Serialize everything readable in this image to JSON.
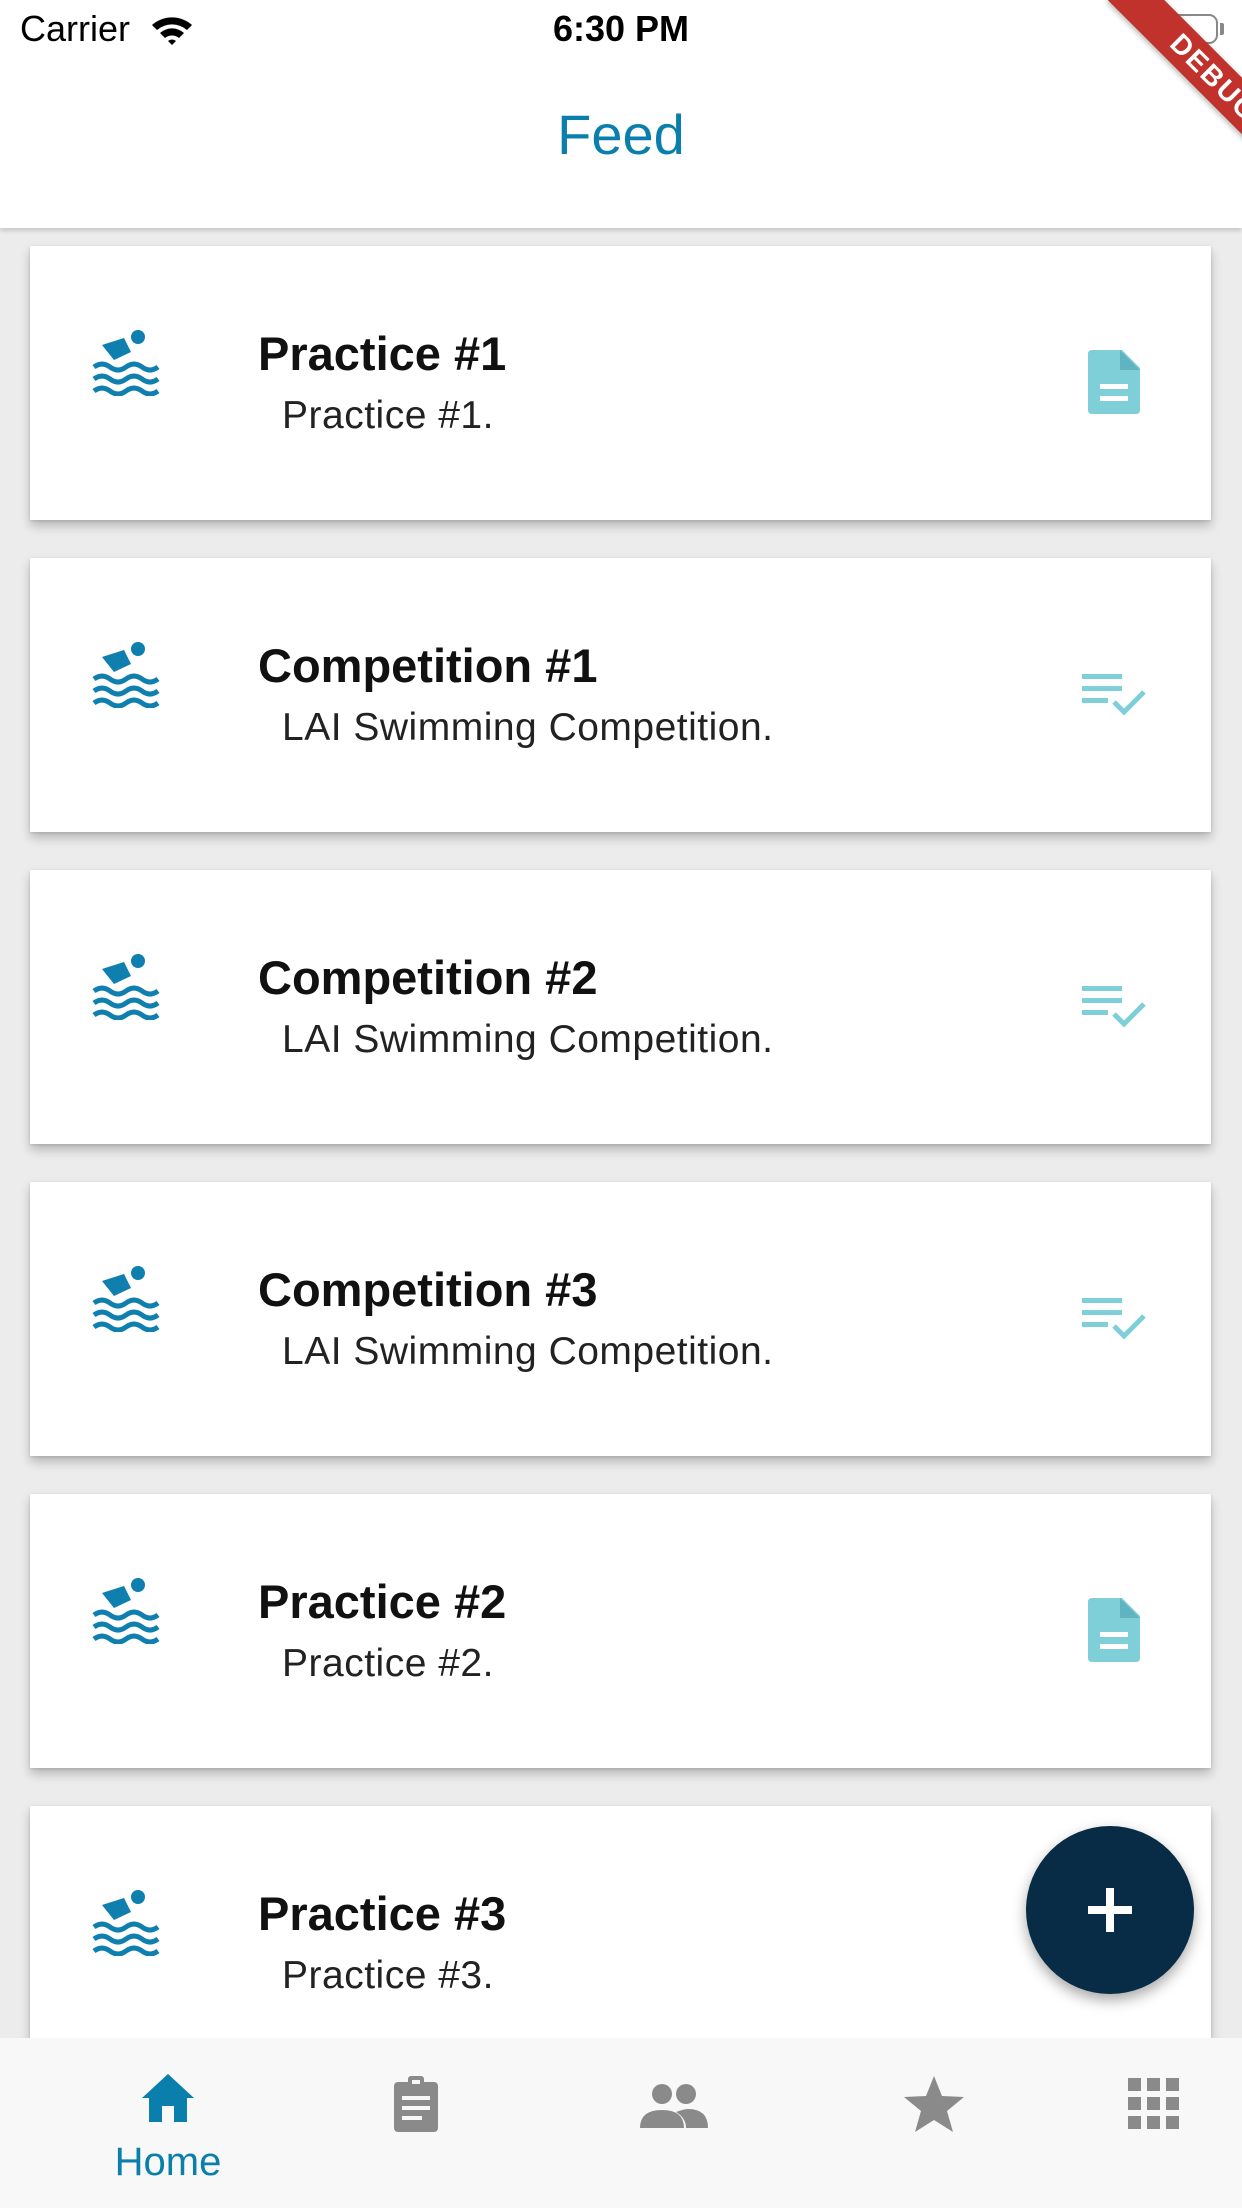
{
  "status_bar": {
    "carrier": "Carrier",
    "time": "6:30 PM",
    "debug_label": "DEBUG"
  },
  "app_bar": {
    "title": "Feed"
  },
  "feed": {
    "items": [
      {
        "title": "Practice #1",
        "subtitle": "Practice #1.",
        "leading_icon": "swimmer-icon",
        "trailing_icon": "document-icon"
      },
      {
        "title": "Competition #1",
        "subtitle": "LAI Swimming Competition.",
        "leading_icon": "swimmer-icon",
        "trailing_icon": "playlist-check-icon"
      },
      {
        "title": "Competition #2",
        "subtitle": "LAI Swimming Competition.",
        "leading_icon": "swimmer-icon",
        "trailing_icon": "playlist-check-icon"
      },
      {
        "title": "Competition #3",
        "subtitle": "LAI Swimming Competition.",
        "leading_icon": "swimmer-icon",
        "trailing_icon": "playlist-check-icon"
      },
      {
        "title": "Practice #2",
        "subtitle": "Practice #2.",
        "leading_icon": "swimmer-icon",
        "trailing_icon": "document-icon"
      },
      {
        "title": "Practice #3",
        "subtitle": "Practice #3.",
        "leading_icon": "swimmer-icon",
        "trailing_icon": "document-icon"
      }
    ]
  },
  "fab": {
    "icon": "plus-icon"
  },
  "bottom_nav": {
    "items": [
      {
        "label": "Home",
        "icon": "home-icon",
        "active": true
      },
      {
        "label": "",
        "icon": "clipboard-icon",
        "active": false
      },
      {
        "label": "",
        "icon": "people-icon",
        "active": false
      },
      {
        "label": "",
        "icon": "star-icon",
        "active": false
      },
      {
        "label": "",
        "icon": "apps-grid-icon",
        "active": false
      }
    ]
  },
  "colors": {
    "primary": "#0a7fab",
    "accent_light": "#7fcfd8",
    "fab": "#082c45",
    "nav_inactive": "#8a8a8a",
    "swimmer": "#0e7fae"
  }
}
